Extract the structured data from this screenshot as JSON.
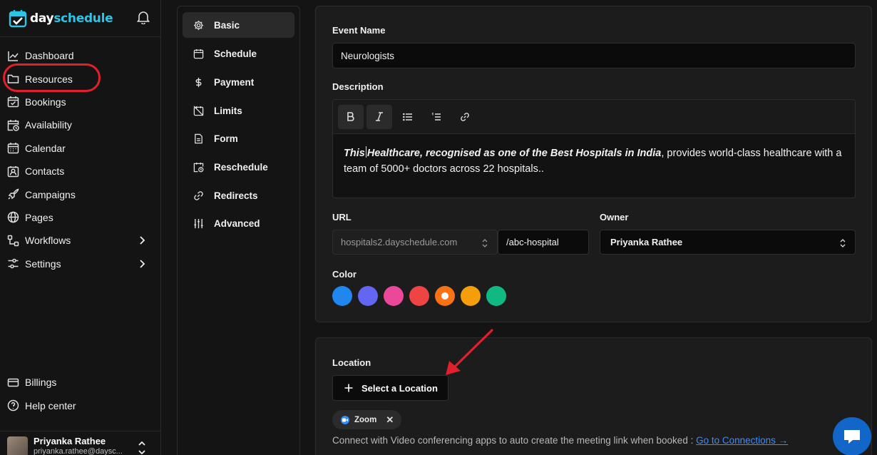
{
  "brand": {
    "part1": "day",
    "part2": "schedule"
  },
  "sidebar": {
    "items": [
      {
        "label": "Dashboard",
        "icon": "chart-line-icon"
      },
      {
        "label": "Resources",
        "icon": "folder-icon"
      },
      {
        "label": "Bookings",
        "icon": "calendar-check-icon"
      },
      {
        "label": "Availability",
        "icon": "calendar-clock-icon"
      },
      {
        "label": "Calendar",
        "icon": "calendar-icon"
      },
      {
        "label": "Contacts",
        "icon": "contact-icon"
      },
      {
        "label": "Campaigns",
        "icon": "rocket-icon"
      },
      {
        "label": "Pages",
        "icon": "globe-icon"
      },
      {
        "label": "Workflows",
        "icon": "workflow-icon"
      },
      {
        "label": "Settings",
        "icon": "sliders-icon"
      }
    ],
    "bottom": [
      {
        "label": "Billings",
        "icon": "credit-card-icon"
      },
      {
        "label": "Help center",
        "icon": "help-circle-icon"
      }
    ],
    "user": {
      "name": "Priyanka Rathee",
      "email": "priyanka.rathee@daysc..."
    }
  },
  "subnav": {
    "items": [
      {
        "label": "Basic",
        "icon": "gear-icon"
      },
      {
        "label": "Schedule",
        "icon": "calendar-icon"
      },
      {
        "label": "Payment",
        "icon": "dollar-icon"
      },
      {
        "label": "Limits",
        "icon": "calendar-off-icon"
      },
      {
        "label": "Form",
        "icon": "file-text-icon"
      },
      {
        "label": "Reschedule",
        "icon": "calendar-clock-icon"
      },
      {
        "label": "Redirects",
        "icon": "link-icon"
      },
      {
        "label": "Advanced",
        "icon": "sliders-vertical-icon"
      }
    ],
    "active": "Basic"
  },
  "form": {
    "event_name_label": "Event Name",
    "event_name_value": "Neurologists",
    "description_label": "Description",
    "description": {
      "bold1": "This",
      "bold2": "Healthcare, recognised as one of the Best Hospitals in India",
      "rest": ", provides world-class healthcare with a team of 5000+ doctors across 22 hospitals.."
    },
    "url_label": "URL",
    "url_domain": "hospitals2.dayschedule.com",
    "url_slug": "/abc-hospital",
    "owner_label": "Owner",
    "owner_value": "Priyanka Rathee",
    "color_label": "Color",
    "colors": [
      "#1f87ef",
      "#6366f1",
      "#ec4899",
      "#ef4444",
      "#f97316",
      "#f59e0b",
      "#10b981"
    ],
    "selected_color": "#f97316"
  },
  "location": {
    "label": "Location",
    "button": "Select a Location",
    "chip": "Zoom",
    "connect_text": "Connect with Video conferencing apps to auto create the meeting link when booked : ",
    "connect_link": "Go to Connections →"
  },
  "annotations": {
    "highlight_color": "#e0202a"
  }
}
